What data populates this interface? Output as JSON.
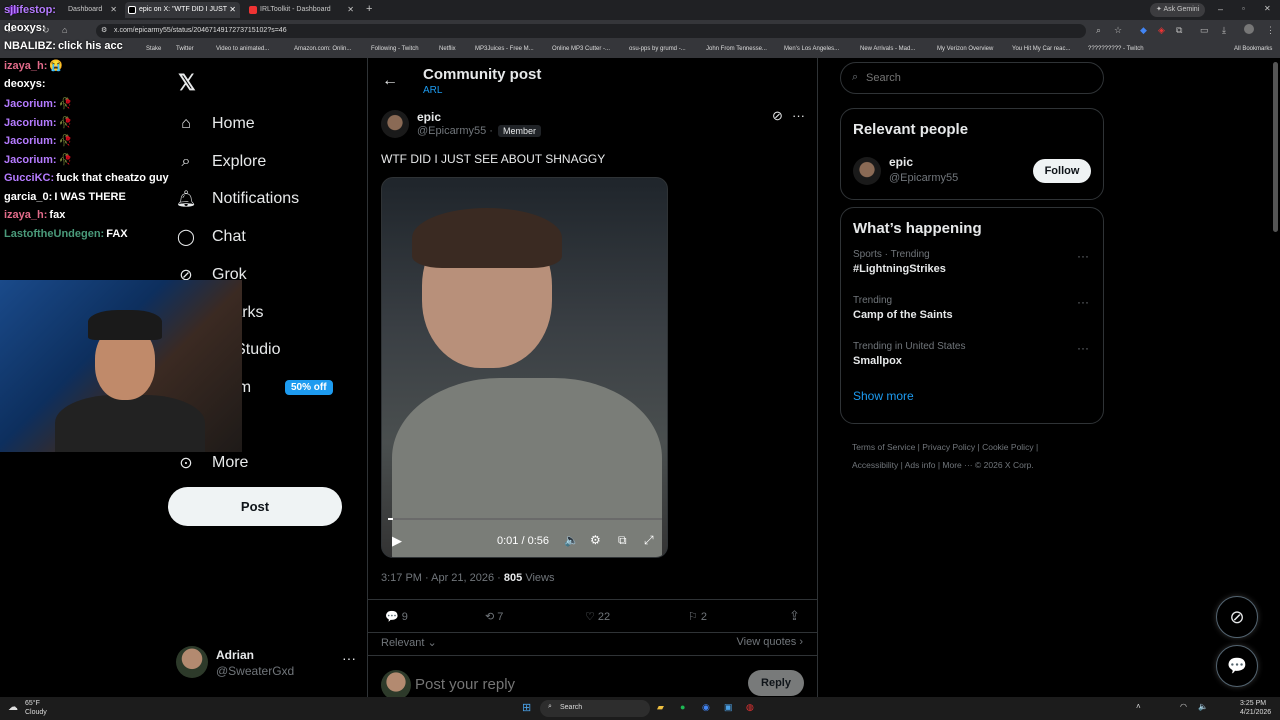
{
  "browser": {
    "tabs": [
      {
        "label": "Dashboard"
      },
      {
        "label": "epic on X: \"WTF DID I JUST"
      },
      {
        "label": "IRLToolkit - Dashboard"
      }
    ],
    "new_tab": "+",
    "url": "x.com/epicarmy55/status/2046714917273715102?s=46",
    "ask_gemini": "Ask Gemini",
    "bookmarks": [
      "Stake",
      "Twitter",
      "Video to animated...",
      "Amazon.com: Onlin...",
      "Following - Twitch",
      "Netflix",
      "MP3Juices - Free M...",
      "Online MP3 Cutter -...",
      "osu-pps by grumd -...",
      "John From Tennesse...",
      "Men's Los Angeles...",
      "New Arrivals - Mad...",
      "My Verizon Overview",
      "You Hit My Car reac...",
      "?????????? - Twitch"
    ],
    "all_bookmarks": "All Bookmarks"
  },
  "overlay_chat": [
    {
      "user": "sjlifestop:",
      "msg": "",
      "color": "#b57bff"
    },
    {
      "user": "deoxys:",
      "msg": "",
      "color": "#ffffff"
    },
    {
      "user": "NBALIBZ:",
      "msg": "click his acc",
      "color": "#ffffff"
    },
    {
      "user": "izaya_h:",
      "msg": "😭",
      "color": "#e36b8a"
    },
    {
      "user": "deoxys:",
      "msg": "",
      "color": "#ffffff"
    },
    {
      "user": "Jacorium:",
      "msg": "🥀",
      "color": "#b57bff"
    },
    {
      "user": "Jacorium:",
      "msg": "🥀",
      "color": "#b57bff"
    },
    {
      "user": "Jacorium:",
      "msg": "🥀",
      "color": "#b57bff"
    },
    {
      "user": "Jacorium:",
      "msg": "🥀",
      "color": "#b57bff"
    },
    {
      "user": "GucciKC:",
      "msg": "fuck that cheatzo guy",
      "color": "#b57bff"
    },
    {
      "user": "garcia_0:",
      "msg": "I WAS THERE",
      "color": "#ffffff"
    },
    {
      "user": "izaya_h:",
      "msg": "fax",
      "color": "#e36b8a"
    },
    {
      "user": "LastoftheUndegen:",
      "msg": "FAX",
      "color": "#4a9a7a"
    }
  ],
  "nav": {
    "items": [
      {
        "label": "Home",
        "icon": "home-icon"
      },
      {
        "label": "Explore",
        "icon": "search-icon"
      },
      {
        "label": "Notifications",
        "icon": "bell-icon"
      },
      {
        "label": "Chat",
        "icon": "chat-icon"
      },
      {
        "label": "Grok",
        "icon": "grok-icon"
      },
      {
        "label": "kmarks",
        "icon": "bookmark-icon"
      },
      {
        "label": "tor Studio",
        "icon": "studio-icon"
      },
      {
        "label": "mium",
        "icon": "premium-icon"
      },
      {
        "label": "le",
        "icon": "profile-icon"
      },
      {
        "label": "More",
        "icon": "more-icon"
      }
    ],
    "premium_badge": "50% off",
    "post_button": "Post"
  },
  "account": {
    "name": "Adrian",
    "handle": "@SweaterGxd"
  },
  "header": {
    "title": "Community post",
    "subtitle": "ARL"
  },
  "post": {
    "author": "epic",
    "handle": "@Epicarmy55",
    "badge": "Member",
    "text": "WTF DID I JUST SEE ABOUT SHNAGGY",
    "video_time": "0:01 / 0:56",
    "video_progress": 0.02,
    "timestamp": "3:17 PM · Apr 21, 2026 ·",
    "views": "805",
    "views_label": "Views",
    "replies": "9",
    "reposts": "7",
    "likes": "22",
    "bookmarks": "2",
    "sort": "Relevant",
    "view_quotes": "View quotes",
    "reply_placeholder": "Post your reply",
    "reply_button": "Reply"
  },
  "sidebar": {
    "search_placeholder": "Search",
    "relevant_title": "Relevant people",
    "person": {
      "name": "epic",
      "handle": "@Epicarmy55",
      "follow": "Follow"
    },
    "happening_title": "What’s happening",
    "trends": [
      {
        "context": "Sports · Trending",
        "name": "#LightningStrikes"
      },
      {
        "context": "Trending",
        "name": "Camp of the Saints"
      },
      {
        "context": "Trending in United States",
        "name": "Smallpox"
      }
    ],
    "show_more": "Show more",
    "footer": [
      "Terms of Service",
      "Privacy Policy",
      "Cookie Policy",
      "Accessibility",
      "Ads info",
      "More ···",
      "© 2026 X Corp."
    ]
  },
  "taskbar": {
    "weather_temp": "65°F",
    "weather_desc": "Cloudy",
    "search": "Search",
    "time": "3:25 PM",
    "date": "4/21/2026"
  }
}
